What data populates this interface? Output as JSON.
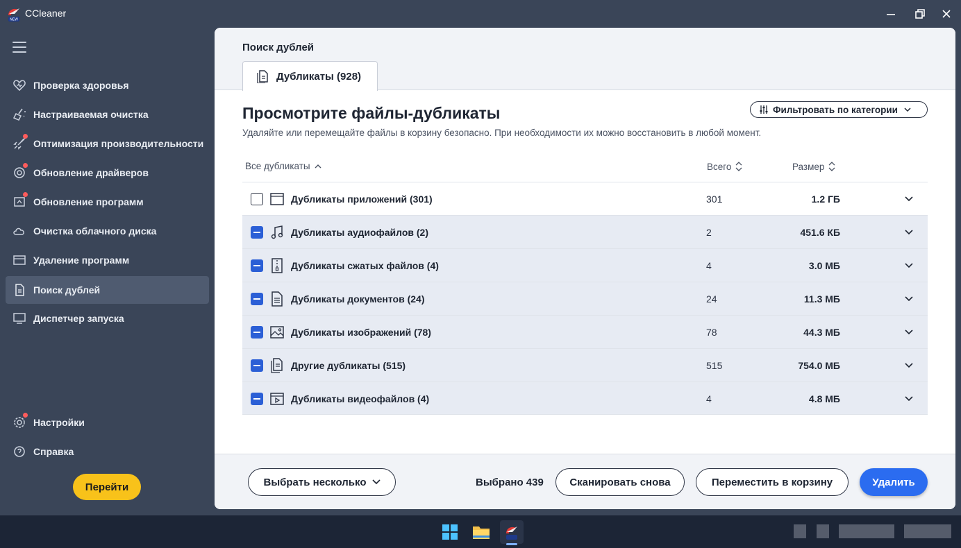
{
  "window": {
    "title": "CCleaner",
    "logo_badge": "NEW"
  },
  "sidebar": {
    "items": [
      {
        "label": "Проверка здоровья",
        "icon": "heart-icon",
        "notify": false,
        "active": false
      },
      {
        "label": "Настраиваемая очистка",
        "icon": "broom-icon",
        "notify": false,
        "active": false
      },
      {
        "label": "Оптимизация производительности",
        "icon": "rocket-icon",
        "notify": true,
        "active": false
      },
      {
        "label": "Обновление драйверов",
        "icon": "driver-gear-icon",
        "notify": true,
        "active": false
      },
      {
        "label": "Обновление программ",
        "icon": "software-update-icon",
        "notify": true,
        "active": false
      },
      {
        "label": "Очистка облачного диска",
        "icon": "cloud-icon",
        "notify": false,
        "active": false
      },
      {
        "label": "Удаление программ",
        "icon": "uninstall-icon",
        "notify": false,
        "active": false
      },
      {
        "label": "Поиск дублей",
        "icon": "duplicate-file-icon",
        "notify": false,
        "active": true
      },
      {
        "label": "Диспетчер запуска",
        "icon": "monitor-icon",
        "notify": false,
        "active": false
      }
    ],
    "settings_label": "Настройки",
    "help_label": "Справка",
    "go_button": "Перейти"
  },
  "header": {
    "section_title": "Поиск дублей",
    "tab_label": "Дубликаты (928)"
  },
  "main": {
    "heading": "Просмотрите файлы-дубликаты",
    "subtitle": "Удаляйте или перемещайте файлы в корзину безопасно. При необходимости их можно восстановить в любой момент.",
    "filter_button": "Фильтровать по категории",
    "columns": {
      "name": "Все дубликаты",
      "total": "Всего",
      "size": "Размер"
    },
    "rows": [
      {
        "label": "Дубликаты приложений (301)",
        "total": "301",
        "size": "1.2 ГБ",
        "icon": "app-window-icon",
        "check": "empty"
      },
      {
        "label": "Дубликаты аудиофайлов (2)",
        "total": "2",
        "size": "451.6 КБ",
        "icon": "music-note-icon",
        "check": "partial"
      },
      {
        "label": "Дубликаты сжатых файлов (4)",
        "total": "4",
        "size": "3.0 МБ",
        "icon": "zip-file-icon",
        "check": "partial"
      },
      {
        "label": "Дубликаты документов (24)",
        "total": "24",
        "size": "11.3 МБ",
        "icon": "document-icon",
        "check": "partial"
      },
      {
        "label": "Дубликаты изображений (78)",
        "total": "78",
        "size": "44.3 МБ",
        "icon": "image-icon",
        "check": "partial"
      },
      {
        "label": "Другие дубликаты (515)",
        "total": "515",
        "size": "754.0 МБ",
        "icon": "files-icon",
        "check": "partial"
      },
      {
        "label": "Дубликаты видеофайлов (4)",
        "total": "4",
        "size": "4.8 МБ",
        "icon": "video-icon",
        "check": "partial"
      }
    ]
  },
  "footer": {
    "select_multiple": "Выбрать несколько",
    "selected_count": "Выбрано 439",
    "rescan": "Сканировать снова",
    "move_to_trash": "Переместить в корзину",
    "delete": "Удалить"
  },
  "colors": {
    "sidebar_bg": "#3a4558",
    "accent_blue": "#2b6cf0",
    "go_yellow": "#f8c21a",
    "notify_red": "#ff5c5c"
  }
}
